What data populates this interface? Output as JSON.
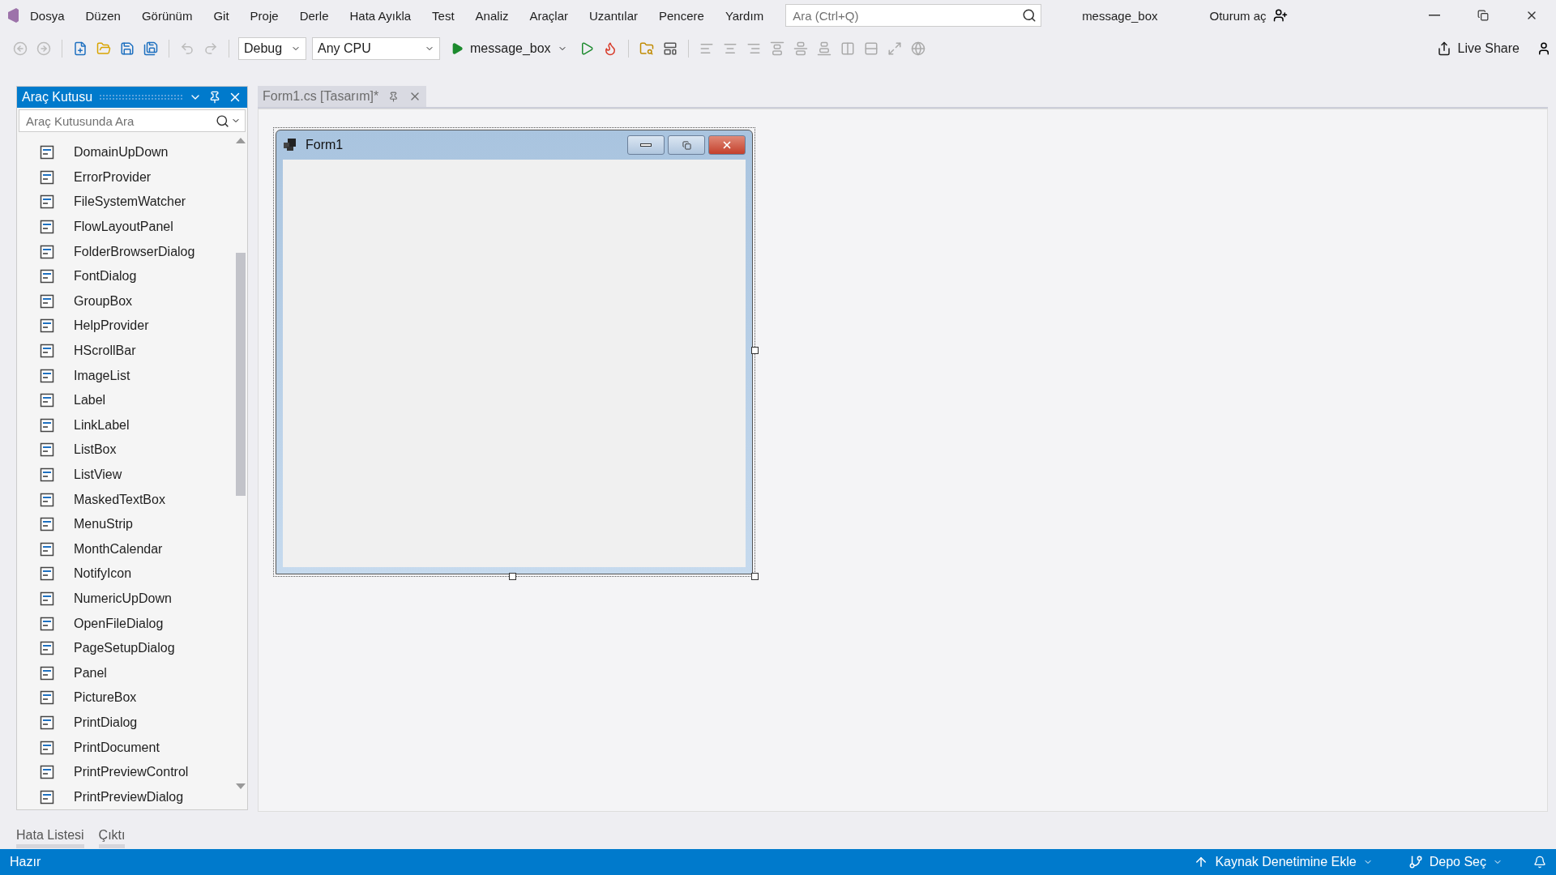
{
  "menu": [
    "Dosya",
    "Düzen",
    "Görünüm",
    "Git",
    "Proje",
    "Derle",
    "Hata Ayıkla",
    "Test",
    "Analiz",
    "Araçlar",
    "Uzantılar",
    "Pencere",
    "Yardım"
  ],
  "search": {
    "placeholder": "Ara (Ctrl+Q)"
  },
  "solution_name": "message_box",
  "sign_in": "Oturum aç",
  "toolbar": {
    "configuration": "Debug",
    "platform": "Any CPU",
    "start_target": "message_box",
    "live_share": "Live Share"
  },
  "toolbox": {
    "title": "Araç Kutusu",
    "search": {
      "placeholder": "Araç Kutusunda Ara"
    },
    "items": [
      "DomainUpDown",
      "ErrorProvider",
      "FileSystemWatcher",
      "FlowLayoutPanel",
      "FolderBrowserDialog",
      "FontDialog",
      "GroupBox",
      "HelpProvider",
      "HScrollBar",
      "ImageList",
      "Label",
      "LinkLabel",
      "ListBox",
      "ListView",
      "MaskedTextBox",
      "MenuStrip",
      "MonthCalendar",
      "NotifyIcon",
      "NumericUpDown",
      "OpenFileDialog",
      "PageSetupDialog",
      "Panel",
      "PictureBox",
      "PrintDialog",
      "PrintDocument",
      "PrintPreviewControl",
      "PrintPreviewDialog"
    ]
  },
  "document_tabs": [
    {
      "label": "Form1.cs [Tasarım]*",
      "selected": true
    }
  ],
  "form": {
    "title": "Form1"
  },
  "bottom_tabs": [
    "Hata Listesi",
    "Çıktı"
  ],
  "status_bar": {
    "state": "Hazır",
    "source_control": "Kaynak Denetimine Ekle",
    "repository": "Depo Seç"
  }
}
